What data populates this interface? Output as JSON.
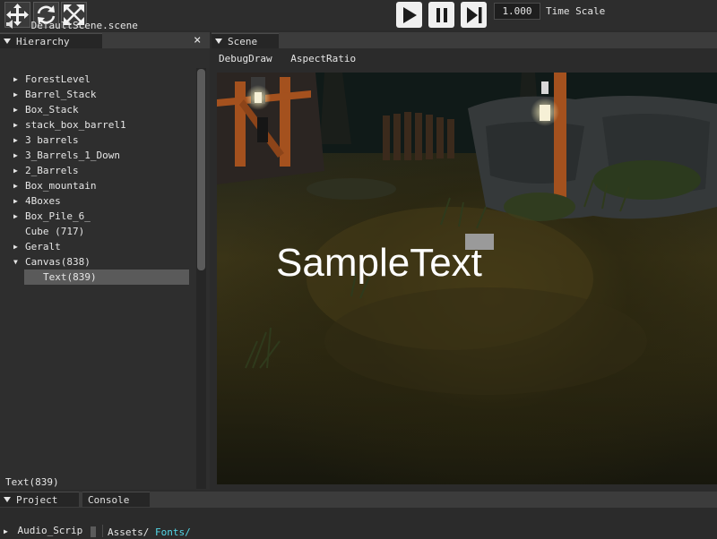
{
  "toolbar": {
    "tools": [
      {
        "name": "move-icon"
      },
      {
        "name": "rotate-icon"
      },
      {
        "name": "scale-icon"
      }
    ],
    "playback": [
      {
        "name": "play-icon"
      },
      {
        "name": "pause-icon"
      },
      {
        "name": "step-icon"
      }
    ],
    "time_scale_value": "1.000",
    "time_scale_label": "Time Scale"
  },
  "hierarchy": {
    "tab_label": "Hierarchy",
    "close_glyph": "×",
    "scene_file": "DefaultScene.scene",
    "items": [
      {
        "label": "ForestLevel",
        "arrow": "▶"
      },
      {
        "label": "Barrel_Stack",
        "arrow": "▶"
      },
      {
        "label": "Box_Stack",
        "arrow": "▶"
      },
      {
        "label": "stack_box_barrel1",
        "arrow": "▶"
      },
      {
        "label": "3 barrels",
        "arrow": "▶"
      },
      {
        "label": "3_Barrels_1_Down",
        "arrow": "▶"
      },
      {
        "label": "2_Barrels",
        "arrow": "▶"
      },
      {
        "label": "Box_mountain",
        "arrow": "▶"
      },
      {
        "label": "4Boxes",
        "arrow": "▶"
      },
      {
        "label": "Box_Pile_6_",
        "arrow": "▶"
      },
      {
        "label": "Cube (717)",
        "arrow": ""
      },
      {
        "label": "Geralt",
        "arrow": "▶"
      },
      {
        "label": "Canvas(838)",
        "arrow": "▼"
      },
      {
        "label": "Text(839)",
        "arrow": "",
        "selected": true
      }
    ],
    "status": "Text(839)"
  },
  "scene": {
    "tab_label": "Scene",
    "menu": [
      "DebugDraw",
      "AspectRatio"
    ],
    "sample_text": "SampleText"
  },
  "bottom": {
    "tabs": [
      "Project",
      "Console"
    ],
    "project_item": "Audio_Scrip",
    "path_prefix": "Assets/",
    "path_link": "Fonts/"
  }
}
